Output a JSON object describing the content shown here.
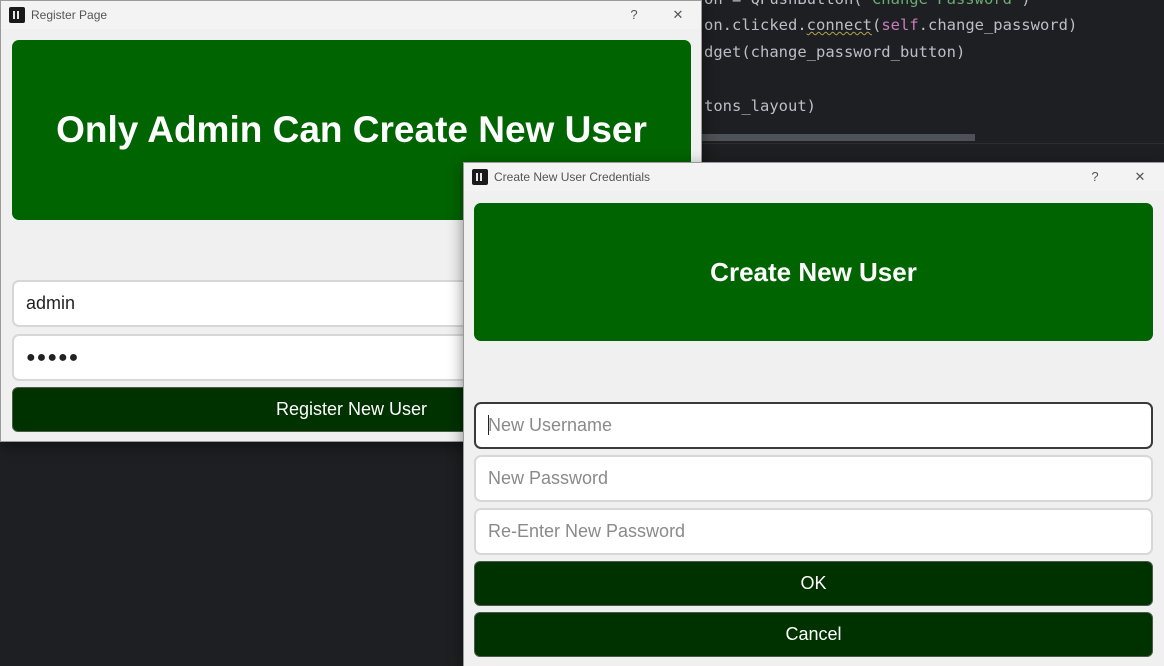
{
  "editor": {
    "lines": [
      {
        "pre": "on = QPushButton(",
        "str": "'Change Password'",
        "post": ")"
      },
      {
        "pre": "on.clicked.",
        "fn": "connect",
        "mid": "(",
        "kw": "self",
        "post": ".change_password)"
      },
      {
        "pre": "dget(change_password_button)"
      },
      {
        "pre": "tons_layout)"
      }
    ]
  },
  "register_window": {
    "title": "Register Page",
    "help": "?",
    "close": "✕",
    "banner": "Only Admin Can Create New User",
    "username_value": "admin",
    "password_value": "●●●●●",
    "register_button": "Register New User"
  },
  "dialog": {
    "title": "Create New User Credentials",
    "help": "?",
    "close": "✕",
    "banner": "Create New User",
    "new_username_placeholder": "New Username",
    "new_password_placeholder": "New Password",
    "reenter_password_placeholder": "Re-Enter New Password",
    "ok_button": "OK",
    "cancel_button": "Cancel"
  },
  "colors": {
    "banner_green": "#006400",
    "button_dark_green": "#003200"
  }
}
